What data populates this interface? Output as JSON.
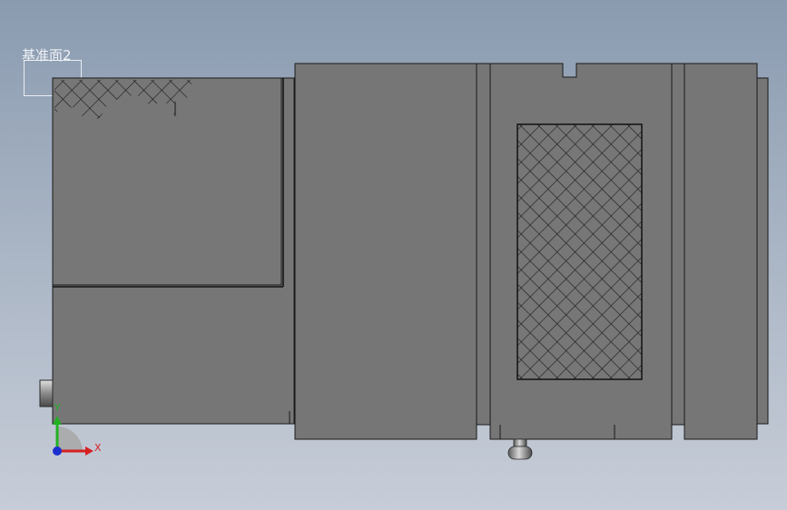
{
  "viewport": {
    "reference_plane_label": "基准面2"
  },
  "triad": {
    "x_label": "X",
    "y_label": "Y",
    "x_color": "#d62020",
    "y_color": "#22b022",
    "z_color": "#1a2fd0"
  },
  "model": {
    "body_color": "#767676",
    "edge_color": "#1a1a1a",
    "hatch": "cross-hatch"
  }
}
